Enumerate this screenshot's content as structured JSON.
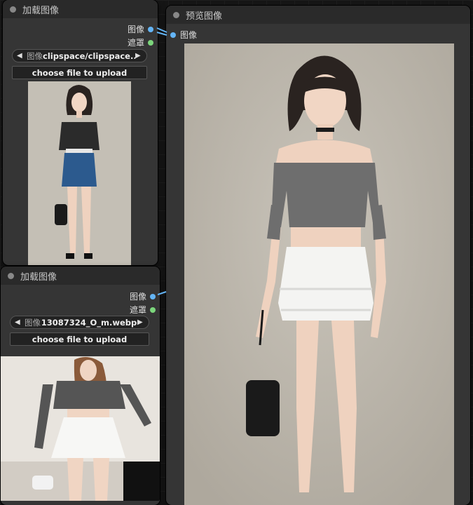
{
  "node1": {
    "title": "加载图像",
    "outputs": [
      "图像",
      "遮罩"
    ],
    "combo_label": "图像",
    "combo_value": "clipspace/clipspace...",
    "upload_label": "choose file to upload"
  },
  "node2": {
    "title": "加载图像",
    "outputs": [
      "图像",
      "遮罩"
    ],
    "combo_label": "图像",
    "combo_value": "13087324_O_m.webp",
    "upload_label": "choose file to upload"
  },
  "preview": {
    "title": "预览图像",
    "input_label": "图像"
  },
  "colors": {
    "node_bg": "#353535",
    "header_bg": "#2a2a2a",
    "slot_image": "#64b5f6",
    "slot_mask": "#7cd67c",
    "canvas_bg": "#161616"
  }
}
